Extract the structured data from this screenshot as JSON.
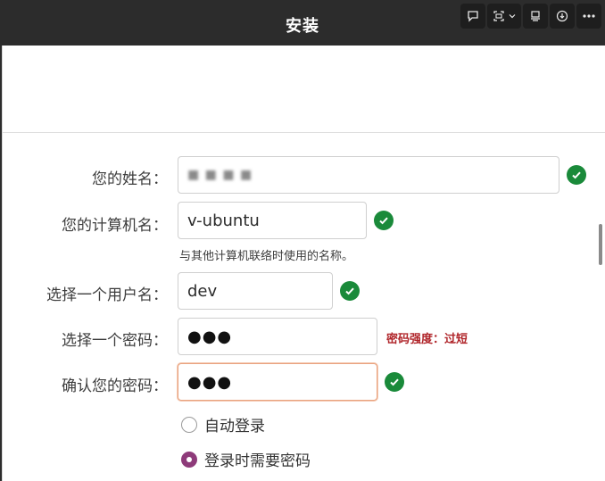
{
  "window": {
    "title": "安装"
  },
  "toolbar": {
    "comment_icon": "speech-bubble-icon",
    "capture_icon": "screen-capture-icon",
    "capture_menu": "chevron-down-icon",
    "pin_icon": "pin-window-icon",
    "download_icon": "download-icon",
    "more_icon": "more-icon"
  },
  "form": {
    "name": {
      "label": "您的姓名：",
      "value": "■ ■ ■ ■"
    },
    "computer": {
      "label": "您的计算机名：",
      "value": "v-ubuntu",
      "hint": "与其他计算机联络时使用的名称。"
    },
    "username": {
      "label": "选择一个用户名：",
      "value": "dev"
    },
    "password": {
      "label": "选择一个密码：",
      "value": "●●●",
      "strength": "密码强度：过短"
    },
    "confirm": {
      "label": "确认您的密码：",
      "value": "●●●"
    }
  },
  "login": {
    "auto_login": "自动登录",
    "require_password": "登录时需要密码",
    "selected": "require_password"
  },
  "colors": {
    "accent": "#8e3b7a",
    "check": "#1a8a3a",
    "warning_text": "#b0252a",
    "focus_border": "#e9a37f"
  }
}
